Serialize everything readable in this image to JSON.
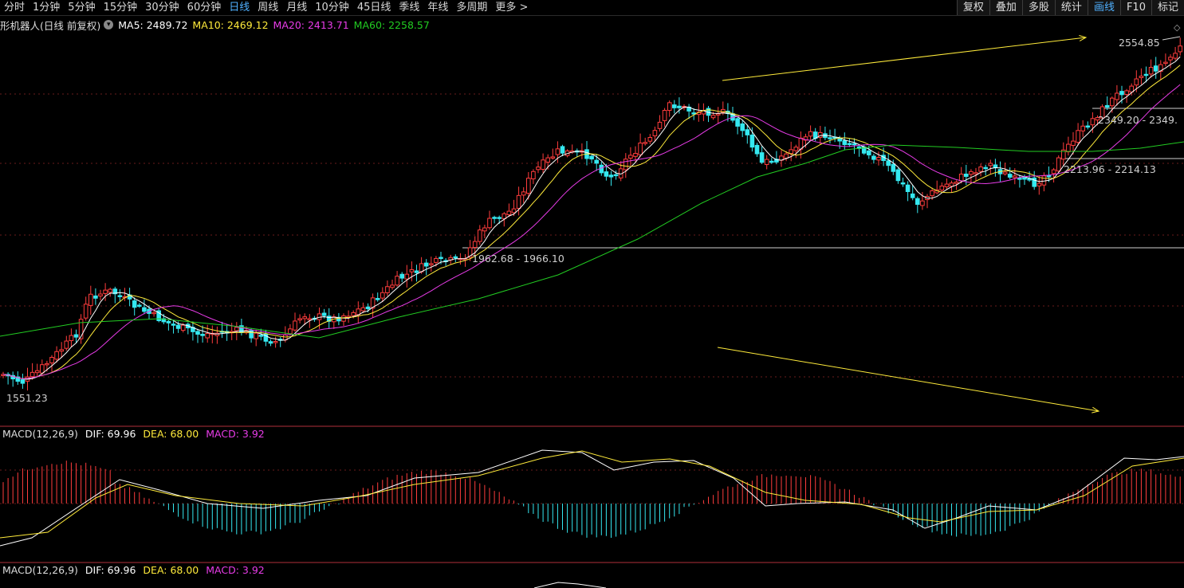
{
  "toolbar": {
    "tabs": [
      "分时",
      "1分钟",
      "5分钟",
      "15分钟",
      "30分钟",
      "60分钟",
      "日线",
      "周线",
      "月线",
      "10分钟",
      "45日线",
      "季线",
      "年线",
      "多周期",
      "更多 >"
    ],
    "active_tab": 6,
    "right_tabs": [
      "复权",
      "叠加",
      "多股",
      "统计",
      "画线",
      "F10",
      "标记"
    ],
    "right_active": 4
  },
  "legend": {
    "title": "形机器人(日线 前复权)",
    "ma5": "MA5: 2489.72",
    "ma10": "MA10: 2469.12",
    "ma20": "MA20: 2413.71",
    "ma60": "MA60: 2258.57"
  },
  "macd1": {
    "name": "MACD(12,26,9)",
    "dif": "DIF: 69.96",
    "dea": "DEA: 68.00",
    "macd": "MACD: 3.92"
  },
  "macd2": {
    "name": "MACD(12,26,9)",
    "dif": "DIF: 69.96",
    "dea": "DEA: 68.00",
    "macd": "MACD: 3.92"
  },
  "price_labels": {
    "high": "2554.85",
    "range1": "2349.20 - 2349.",
    "range2": "2213.96 - 2214.13",
    "range3": "1962.68 - 1966.10",
    "low": "1551.23"
  },
  "colors": {
    "up": "#ff3d3d",
    "down": "#35e8f0",
    "ma5": "#ffffff",
    "ma10": "#ffeb3b",
    "ma20": "#e83ce8",
    "ma60": "#22cc22",
    "accent": "#4fb0ff"
  },
  "chart_data": {
    "type": "candlestick",
    "series": [
      {
        "name": "MA5",
        "value": 2489.72
      },
      {
        "name": "MA10",
        "value": 2469.12
      },
      {
        "name": "MA20",
        "value": 2413.71
      },
      {
        "name": "MA60",
        "value": 2258.57
      }
    ],
    "marked_values": [
      2554.85,
      2349.2,
      2213.96,
      2214.13,
      1962.68,
      1966.1,
      1551.23
    ],
    "macd": {
      "dif": 69.96,
      "dea": 68.0,
      "macd": 3.92
    }
  }
}
